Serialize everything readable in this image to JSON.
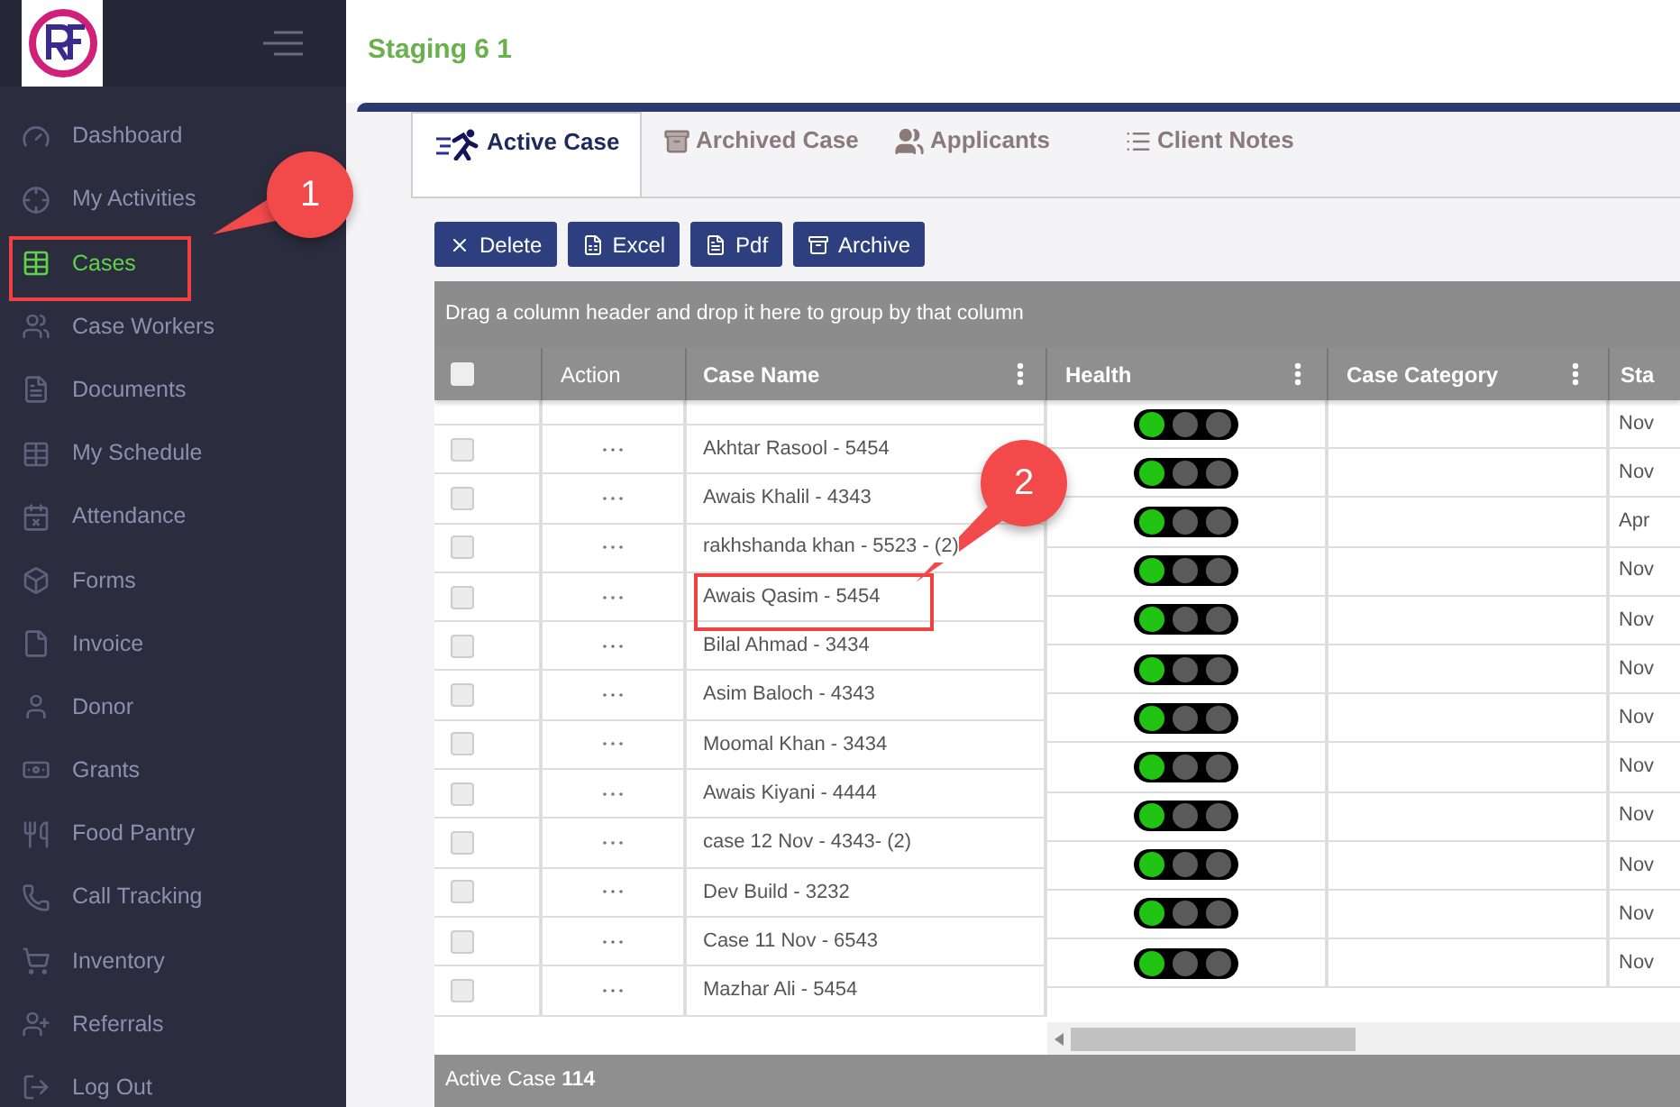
{
  "header": {
    "title": "Staging 6 1"
  },
  "sidebar": {
    "items": [
      {
        "label": "Dashboard",
        "selected": false
      },
      {
        "label": "My Activities",
        "selected": false
      },
      {
        "label": "Cases",
        "selected": true
      },
      {
        "label": "Case Workers",
        "selected": false
      },
      {
        "label": "Documents",
        "selected": false
      },
      {
        "label": "My Schedule",
        "selected": false
      },
      {
        "label": "Attendance",
        "selected": false
      },
      {
        "label": "Forms",
        "selected": false
      },
      {
        "label": "Invoice",
        "selected": false
      },
      {
        "label": "Donor",
        "selected": false
      },
      {
        "label": "Grants",
        "selected": false
      },
      {
        "label": "Food Pantry",
        "selected": false
      },
      {
        "label": "Call Tracking",
        "selected": false
      },
      {
        "label": "Inventory",
        "selected": false
      },
      {
        "label": "Referrals",
        "selected": false
      },
      {
        "label": "Log Out",
        "selected": false
      }
    ]
  },
  "tabs": [
    {
      "label": "Active Case",
      "selected": true
    },
    {
      "label": "Archived Case",
      "selected": false
    },
    {
      "label": "Applicants",
      "selected": false
    },
    {
      "label": "Client Notes",
      "selected": false
    }
  ],
  "toolbar": [
    "Delete",
    "Excel",
    "Pdf",
    "Archive"
  ],
  "group_bar": "Drag a column header and drop it here to group by that column",
  "table": {
    "select_all": {
      "checked": false
    },
    "columns": [
      "Action",
      "Case Name",
      "Health",
      "Case Category",
      "Sta"
    ],
    "left_rows": [
      {
        "case_name": "Akhtar Rasool - 5454",
        "checked": false
      },
      {
        "case_name": "Awais Khalil - 4343",
        "checked": false
      },
      {
        "case_name": "rakhshanda khan - 5523 - (2)",
        "checked": false
      },
      {
        "case_name": "Awais Qasim - 5454",
        "checked": false
      },
      {
        "case_name": "Bilal Ahmad - 3434",
        "checked": false
      },
      {
        "case_name": "Asim Baloch - 4343",
        "checked": false
      },
      {
        "case_name": "Moomal Khan - 3434",
        "checked": false
      },
      {
        "case_name": "Awais Kiyani - 4444",
        "checked": false
      },
      {
        "case_name": "case 12 Nov - 4343- (2)",
        "checked": false
      },
      {
        "case_name": "Dev Build - 3232",
        "checked": false
      },
      {
        "case_name": "Case 11 Nov - 6543",
        "checked": false
      },
      {
        "case_name": "Mazhar Ali - 5454",
        "checked": false
      }
    ],
    "right_rows": [
      {
        "color": "#22c414",
        "start": "Nov"
      },
      {
        "color": "#22c414",
        "start": "Nov"
      },
      {
        "color": "#22c414",
        "start": "Apr"
      },
      {
        "color": "#22c414",
        "start": "Nov"
      },
      {
        "color": "#22c414",
        "start": "Nov"
      },
      {
        "color": "#22c414",
        "start": "Nov"
      },
      {
        "color": "#22c414",
        "start": "Nov"
      },
      {
        "color": "#22c414",
        "start": "Nov"
      },
      {
        "color": "#22c414",
        "start": "Nov"
      },
      {
        "color": "#22c414",
        "start": "Nov"
      },
      {
        "color": "#22c414",
        "start": "Nov"
      },
      {
        "color": "#22c414",
        "start": "Nov"
      }
    ]
  },
  "footer": "Active Case **114**",
  "annotations": [
    {
      "label": "1"
    },
    {
      "label": "2"
    }
  ]
}
